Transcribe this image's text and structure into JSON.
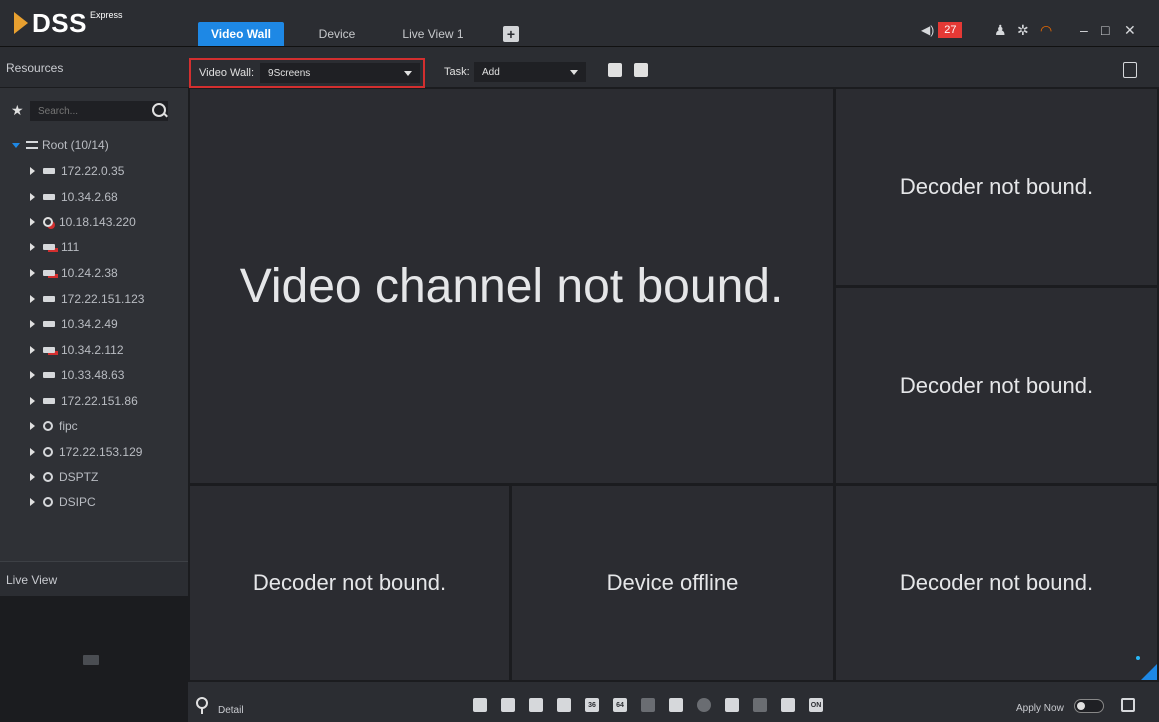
{
  "app": {
    "name": "DSS",
    "edition": "Express"
  },
  "tabs": [
    {
      "label": "Video Wall",
      "active": true
    },
    {
      "label": "Device"
    },
    {
      "label": "Live View 1"
    }
  ],
  "header": {
    "alarm_count": "27",
    "icons": [
      "speaker-icon",
      "user-icon",
      "gear-icon",
      "speedometer-icon",
      "minimize-icon",
      "maximize-icon",
      "close-icon"
    ]
  },
  "toolbar": {
    "video_wall_label": "Video Wall:",
    "video_wall_value": "9Screens",
    "task_label": "Task:",
    "task_value": "Add"
  },
  "sidebar": {
    "resources_title": "Resources",
    "search_placeholder": "Search...",
    "root_label": "Root (10/14)",
    "devices": [
      {
        "label": "172.22.0.35",
        "icon": "nvr"
      },
      {
        "label": "10.34.2.68",
        "icon": "nvr"
      },
      {
        "label": "10.18.143.220",
        "icon": "camera-alert"
      },
      {
        "label": "111",
        "icon": "nvr-alert"
      },
      {
        "label": "10.24.2.38",
        "icon": "nvr-alert"
      },
      {
        "label": "172.22.151.123",
        "icon": "nvr"
      },
      {
        "label": "10.34.2.49",
        "icon": "nvr"
      },
      {
        "label": "10.34.2.112",
        "icon": "nvr-alert"
      },
      {
        "label": "10.33.48.63",
        "icon": "nvr"
      },
      {
        "label": "172.22.151.86",
        "icon": "nvr"
      },
      {
        "label": "fipc",
        "icon": "camera"
      },
      {
        "label": "172.22.153.129",
        "icon": "camera"
      },
      {
        "label": "DSPTZ",
        "icon": "camera"
      },
      {
        "label": "DSIPC",
        "icon": "camera"
      }
    ],
    "live_view_title": "Live View"
  },
  "wall": {
    "main": "Video channel not bound.",
    "r1": "Decoder not bound.",
    "r2": "Decoder not bound.",
    "b1": "Decoder not bound.",
    "b2": "Device offline",
    "b3": "Decoder not bound."
  },
  "bottom": {
    "detail_label": "Detail",
    "apply_label": "Apply Now",
    "layout_36": "36",
    "layout_64": "64",
    "on_label": "ON"
  },
  "colors": {
    "accent": "#1e88e5",
    "alert": "#e53935",
    "highlight_border": "#d32f2f"
  }
}
